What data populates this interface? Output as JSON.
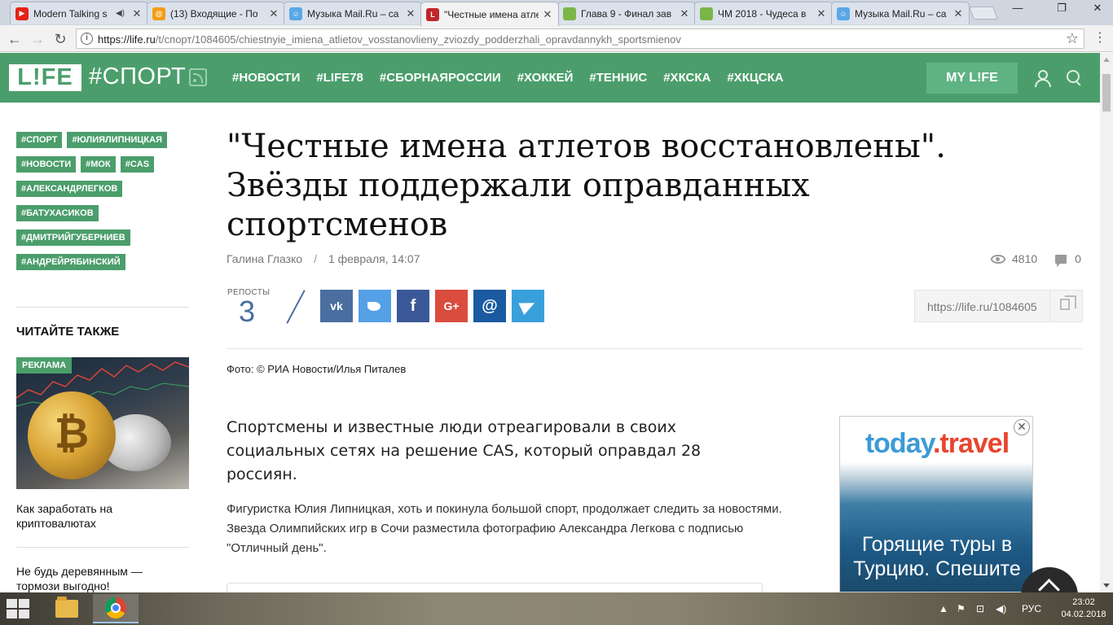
{
  "browser": {
    "tabs": [
      {
        "title": "Modern Talking s",
        "icon": "youtube-icon",
        "color": "#e62117",
        "sound": true
      },
      {
        "title": "(13) Входящие - По",
        "icon": "mail-at-icon",
        "color": "#f39c12"
      },
      {
        "title": "Музыка Mail.Ru – са",
        "icon": "mailru-music-icon",
        "color": "#5aa7e6"
      },
      {
        "title": "\"Честные имена атле",
        "icon": "life-icon",
        "color": "#c0262c",
        "active": true
      },
      {
        "title": "Глава 9 - Финал зав",
        "icon": "green-square-icon",
        "color": "#7ab648"
      },
      {
        "title": "ЧМ 2018 - Чудеса в",
        "icon": "green-square-icon",
        "color": "#7ab648"
      },
      {
        "title": "Музыка Mail.Ru – са",
        "icon": "mailru-music-icon",
        "color": "#5aa7e6"
      }
    ],
    "url_host": "https://life.ru",
    "url_path": "/t/спорт/1084605/chiestnyie_imiena_atlietov_vosstanovlieny_zviozdy_podderzhali_opravdannykh_sportsmienov"
  },
  "header": {
    "logo": "L!FE",
    "section": "#СПОРТ",
    "nav": [
      "#НОВОСТИ",
      "#LIFE78",
      "#СБОРНАЯРОССИИ",
      "#ХОККЕЙ",
      "#ТЕННИС",
      "#ХКСКА",
      "#ХКЦСКА"
    ],
    "my_life": "MY L!FE"
  },
  "sidebar": {
    "tags": [
      "#СПОРТ",
      "#ЮЛИЯЛИПНИЦКАЯ",
      "#НОВОСТИ",
      "#МОК",
      "#CAS",
      "#АЛЕКСАНДРЛЕГКОВ",
      "#БАТУХАСИКОВ",
      "#ДМИТРИЙГУБЕРНИЕВ",
      "#АНДРЕЙРЯБИНСКИЙ"
    ],
    "also_title": "ЧИТАЙТЕ ТАКЖЕ",
    "ad_badge": "РЕКЛАМА",
    "item1": "Как заработать на криптовалютах",
    "item2": "Не будь деревянным — тормози выгодно!"
  },
  "article": {
    "title": "\"Честные имена атлетов восстановлены\". Звёзды поддержали оправданных спортсменов",
    "author": "Галина Глазко",
    "separator": "/",
    "date": "1 февраля, 14:07",
    "views": "4810",
    "comments": "0",
    "reposts_label": "РЕПОСТЫ",
    "reposts_count": "3",
    "shares": [
      {
        "name": "vk",
        "glyph": "vk"
      },
      {
        "name": "twitter",
        "glyph": ""
      },
      {
        "name": "facebook",
        "glyph": "f"
      },
      {
        "name": "google-plus",
        "glyph": "G+"
      },
      {
        "name": "mailru",
        "glyph": "@"
      },
      {
        "name": "telegram",
        "glyph": ""
      }
    ],
    "short_link": "https://life.ru/1084605",
    "photo_credit": "Фото: © РИА Новости/Илья Питалев",
    "lead": "Спортсмены и известные люди отреагировали в своих социальных сетях на решение CAS, который оправдал 28 россиян.",
    "paragraph": "Фигуристка Юлия Липницкая, хоть и покинула большой спорт, продолжает следить за новостями. Звезда Олимпийских игр в Сочи разместила фотографию Александра Легкова с подписью \"Отличный день\"."
  },
  "ad": {
    "brand_part1": "today",
    "brand_part2": ".travel",
    "headline": "Горящие туры в Турцию. Спешите"
  },
  "taskbar": {
    "lang": "РУС",
    "time": "23:02",
    "date": "04.02.2018"
  },
  "colors": {
    "brand_green": "#4b9e6b",
    "vk": "#4a6ea0",
    "twitter": "#55a0e6",
    "facebook": "#3b5998",
    "google_plus": "#d94c3e",
    "mailru": "#1a5aa0",
    "telegram": "#39a0dc"
  }
}
